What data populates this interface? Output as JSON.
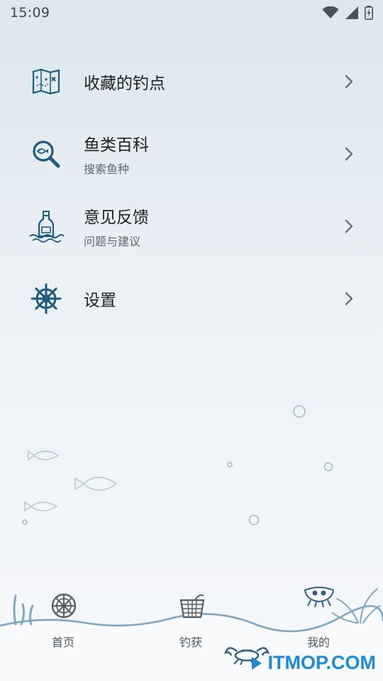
{
  "status_bar": {
    "time": "15:09",
    "icons": [
      "wifi-icon",
      "cell-signal-icon",
      "battery-charging-icon"
    ]
  },
  "menu": {
    "items": [
      {
        "title": "收藏的钓点",
        "subtitle": "",
        "icon": "treasure-map-icon"
      },
      {
        "title": "鱼类百科",
        "subtitle": "搜索鱼种",
        "icon": "fish-magnifier-icon"
      },
      {
        "title": "意见反馈",
        "subtitle": "问题与建议",
        "icon": "message-bottle-icon"
      },
      {
        "title": "设置",
        "subtitle": "",
        "icon": "ship-wheel-icon"
      }
    ]
  },
  "bottom_nav": {
    "tabs": [
      {
        "label": "首页",
        "icon": "ship-wheel-icon"
      },
      {
        "label": "钓获",
        "icon": "fish-basket-icon"
      },
      {
        "label": "我的",
        "icon": "crab-icon",
        "selected": true
      }
    ]
  },
  "watermark": {
    "text": "ITMOP.COM",
    "icon": "itmop-logo-icon"
  },
  "colors": {
    "accent": "#1f5a80",
    "deco": "#7fa6c2",
    "watermark": "#1c8ad6"
  }
}
